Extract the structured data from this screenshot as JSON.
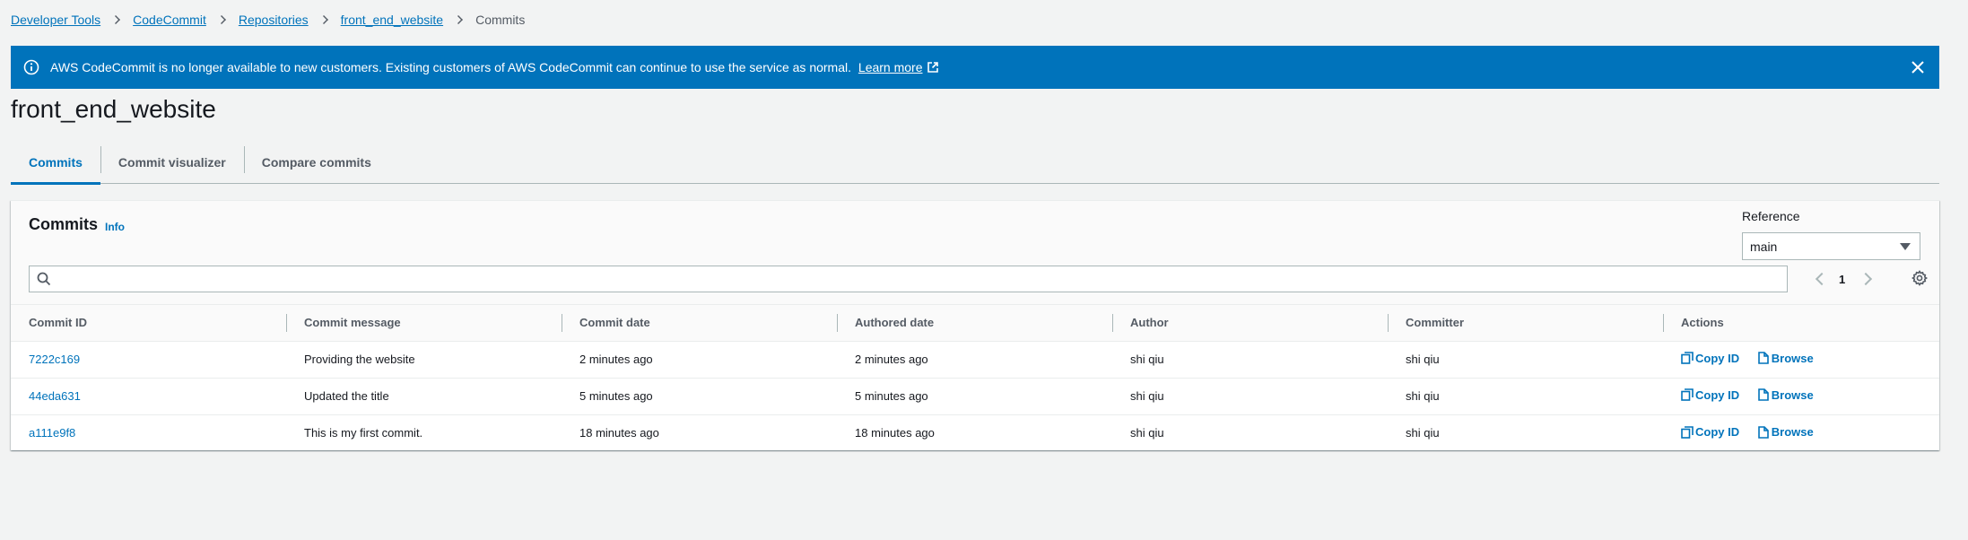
{
  "breadcrumb": {
    "items": [
      "Developer Tools",
      "CodeCommit",
      "Repositories",
      "front_end_website"
    ],
    "current": "Commits"
  },
  "flash": {
    "message": "AWS CodeCommit is no longer available to new customers. Existing customers of AWS CodeCommit can continue to use the service as normal.",
    "link": "Learn more",
    "color": "#0073bb"
  },
  "page": {
    "title": "front_end_website"
  },
  "tabs": [
    "Commits",
    "Commit visualizer",
    "Compare commits"
  ],
  "panel": {
    "title": "Commits",
    "info": "Info",
    "reference_label": "Reference",
    "reference_value": "main",
    "search_placeholder": "",
    "page_number": "1"
  },
  "table": {
    "columns": [
      "Commit ID",
      "Commit message",
      "Commit date",
      "Authored date",
      "Author",
      "Committer",
      "Actions"
    ],
    "rows": [
      {
        "id": "7222c169",
        "message": "Providing the website",
        "commit_date": "2 minutes ago",
        "authored_date": "2 minutes ago",
        "author": "shi qiu",
        "committer": "shi qiu"
      },
      {
        "id": "44eda631",
        "message": "Updated the title",
        "commit_date": "5 minutes ago",
        "authored_date": "5 minutes ago",
        "author": "shi qiu",
        "committer": "shi qiu"
      },
      {
        "id": "a111e9f8",
        "message": "This is my first commit.",
        "commit_date": "18 minutes ago",
        "authored_date": "18 minutes ago",
        "author": "shi qiu",
        "committer": "shi qiu"
      }
    ],
    "actions": {
      "copy": "Copy ID",
      "browse": "Browse"
    }
  },
  "colors": {
    "link": "#0073bb",
    "background": "#f2f3f3"
  }
}
